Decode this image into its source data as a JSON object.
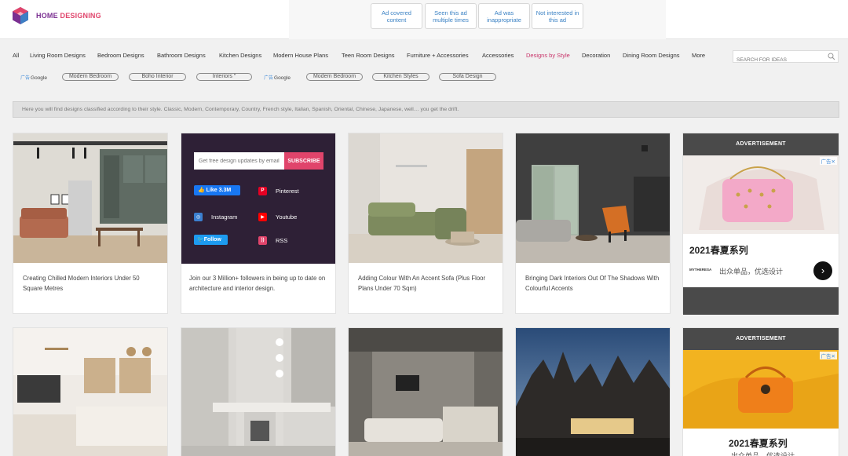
{
  "header": {
    "brand": {
      "part1": "HOME",
      "part2": "DESIGNING"
    },
    "ad_options": [
      "Ad covered content",
      "Seen this ad multiple times",
      "Ad was inappropriate",
      "Not interested in this ad"
    ]
  },
  "nav": {
    "items": [
      "All",
      "Living Room Designs",
      "Bedroom Designs",
      "Bathroom Designs",
      "Kitchen Designs",
      "Modern House Plans",
      "Teen Room Designs",
      "Furniture + Accessories",
      "Accessories",
      "Designs by Style",
      "Decoration",
      "Dining Room Designs",
      "More"
    ],
    "active": "Designs by Style",
    "search_placeholder": "SEARCH FOR IDEAS"
  },
  "tags": {
    "ad_mark": "广告",
    "google": "Google",
    "group1": [
      "Modern Bedroom",
      "Boho Interior",
      "Interiors \""
    ],
    "group2": [
      "Modern Bedroom",
      "Kitchen Styles",
      "Sofa Design"
    ]
  },
  "info_text": "Here you will find designs classified according to their style. Classic, Modern, Contemporary, Country, French style, Italian, Spanish, Oriental, Chinese, Japanese, well… you get the drift.",
  "cards": {
    "c1": "Creating Chilled Modern Interiors Under 50 Square Metres",
    "c3": "Adding Colour With An Accent Sofa (Plus Floor Plans Under 70 Sqm)",
    "c4": "Bringing Dark Interiors Out Of The Shadows With Colourful Accents"
  },
  "social": {
    "email_placeholder": "Get free design updates by email",
    "subscribe": "SUBSCRIBE",
    "fb_like": "Like 3.3M",
    "pinterest": "Pinterest",
    "instagram": "Instagram",
    "youtube": "Youtube",
    "twitter_follow": "Follow",
    "rss": "RSS",
    "caption": "Join our 3 Million+ followers in being up to date on architecture and interior design."
  },
  "ads": {
    "heading": "ADVERTISEMENT",
    "ad_tag": "广告✕",
    "title": "2021春夏系列",
    "subtitle": "出众单品，优选设计",
    "brand_logo": "MYTHERESA",
    "next": "›"
  }
}
